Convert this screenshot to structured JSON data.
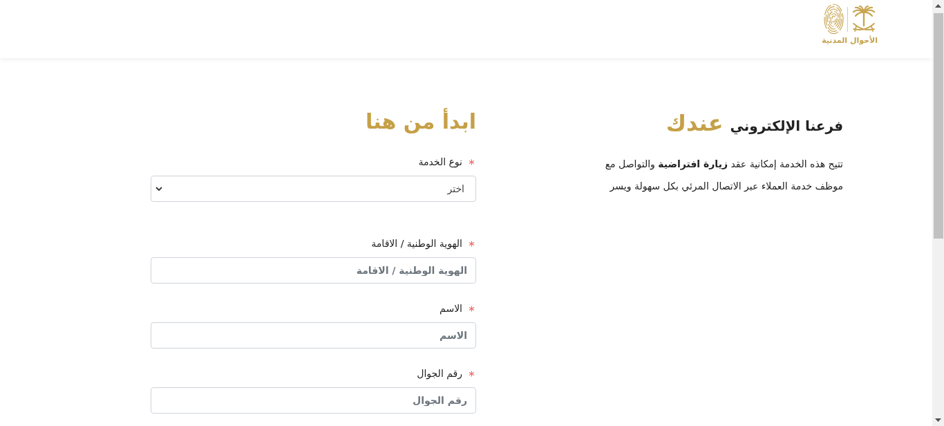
{
  "header": {
    "logo": {
      "text": "الأحوال المدنية"
    }
  },
  "intro": {
    "title": "فرعنا الإلكتروني",
    "highlight": "عندك",
    "text": "تتيح هذه الخدمة إمكانية عقد **زيارة افتراضية** والتواصل مع موظف خدمة العملاء عبر الاتصال المرئي بكل سهولة ويسر"
  },
  "form": {
    "title": "ابدأ من هنا",
    "fields": [
      {
        "kind": "select",
        "label": "نوع الخدمة",
        "required": true,
        "value": "اختر"
      },
      {
        "kind": "text",
        "label": "الهوية الوطنية / الاقامة",
        "required": true,
        "placeholder": "الهوية الوطنية / الاقامة"
      },
      {
        "kind": "text",
        "label": "الاسم",
        "required": true,
        "placeholder": "الاسم"
      },
      {
        "kind": "text",
        "label": "رقم الجوال",
        "required": true,
        "placeholder": "رقم الجوال"
      }
    ]
  }
}
